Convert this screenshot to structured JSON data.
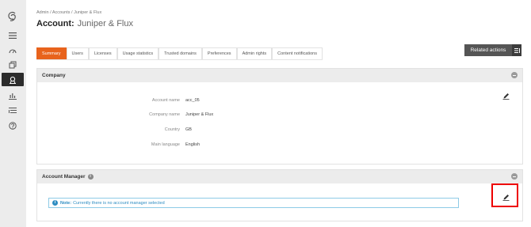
{
  "sidebar": {
    "items": [
      {
        "icon": "logo-icon"
      },
      {
        "icon": "menu-icon"
      },
      {
        "icon": "dashboard-icon"
      },
      {
        "icon": "copy-icon"
      },
      {
        "icon": "account-icon",
        "active": true
      },
      {
        "icon": "chart-icon"
      },
      {
        "icon": "list-icon"
      },
      {
        "icon": "help-icon"
      }
    ]
  },
  "header": {
    "breadcrumb": "Admin / Accounts / Juniper & Flux",
    "title_prefix": "Account:",
    "title_name": "Juniper & Flux"
  },
  "tabs": [
    "Summary",
    "Users",
    "Licenses",
    "Usage statistics",
    "Trusted domains",
    "Preferences",
    "Admin rights",
    "Content notifications"
  ],
  "related_actions": "Related actions",
  "company": {
    "heading": "Company",
    "fields": [
      {
        "label": "Account name",
        "value": "acc_05"
      },
      {
        "label": "Company name",
        "value": "Juniper & Flux"
      },
      {
        "label": "Country",
        "value": "GB"
      },
      {
        "label": "Main language",
        "value": "English"
      }
    ]
  },
  "account_manager": {
    "heading": "Account Manager",
    "note_bold": "Note:",
    "note_text": "Currently there is no account manager selected"
  },
  "colors": {
    "accent": "#e8631c",
    "info": "#2e8dc2",
    "highlight": "#e00000"
  }
}
